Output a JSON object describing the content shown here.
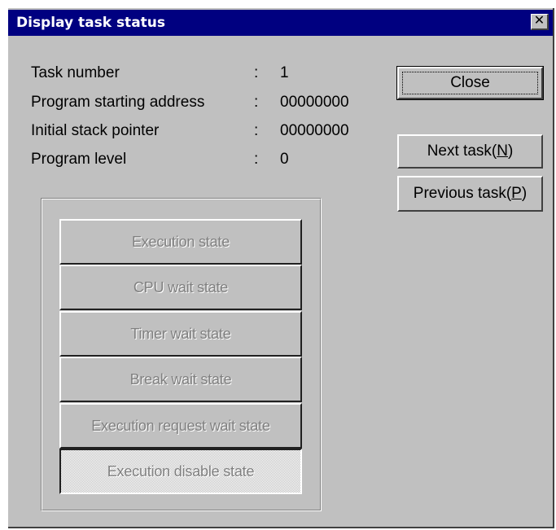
{
  "window": {
    "title": "Display task status",
    "close_glyph": "✕"
  },
  "info": [
    {
      "label": "Task number",
      "colon": ":",
      "value": "1"
    },
    {
      "label": "Program starting address",
      "colon": ":",
      "value": "00000000"
    },
    {
      "label": "Initial stack pointer",
      "colon": ":",
      "value": "00000000"
    },
    {
      "label": "Program level",
      "colon": ":",
      "value": "0"
    }
  ],
  "buttons": {
    "close": "Close",
    "next": {
      "prefix": "Next task(",
      "mnemonic": "N",
      "suffix": ")"
    },
    "previous": {
      "prefix": "Previous task(",
      "mnemonic": "P",
      "suffix": ")"
    }
  },
  "states": [
    {
      "label": "Execution state",
      "pressed": false
    },
    {
      "label": "CPU wait state",
      "pressed": false
    },
    {
      "label": "Timer wait state",
      "pressed": false
    },
    {
      "label": "Break wait state",
      "pressed": false
    },
    {
      "label": "Execution request wait state",
      "pressed": false
    },
    {
      "label": "Execution disable state",
      "pressed": true
    }
  ],
  "colors": {
    "titlebar": "#000080",
    "face": "#c0c0c0",
    "disabled_text": "#808080"
  }
}
